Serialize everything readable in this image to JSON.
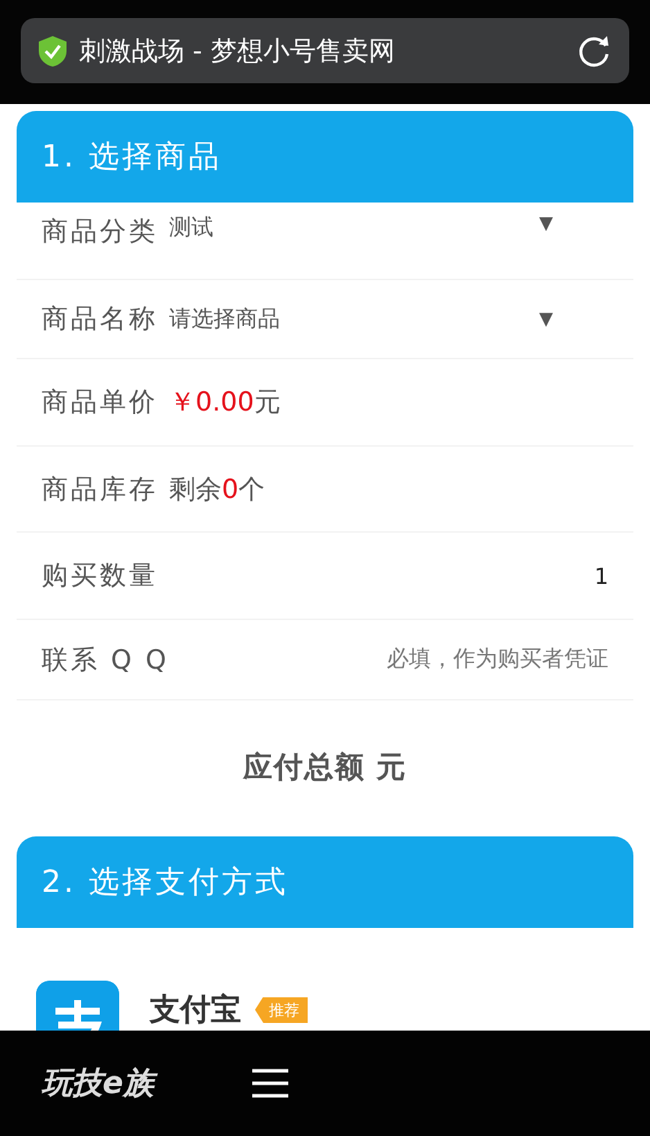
{
  "address_bar": {
    "title": "刺激战场 - 梦想小号售卖网",
    "secure": true
  },
  "product_section": {
    "heading": "1. 选择商品",
    "rows": [
      {
        "kind": "select",
        "label": "商品分类",
        "value": "测试",
        "arrow": "▼"
      },
      {
        "kind": "select",
        "label": "商品名称",
        "value": "请选择商品",
        "arrow": "▼"
      },
      {
        "kind": "price",
        "label": "商品单价",
        "amount": "￥0.00",
        "unit": "元"
      },
      {
        "kind": "stock",
        "label": "商品库存",
        "prefix": "剩余",
        "count": "0",
        "unit": "个"
      },
      {
        "kind": "input",
        "label": "购买数量",
        "value": "1"
      },
      {
        "kind": "input",
        "label": "联系 Q Q",
        "placeholder": "必填，作为购买者凭证"
      }
    ]
  },
  "total": "应付总额 元",
  "payment_section": {
    "heading": "2. 选择支付方式",
    "methods": [
      {
        "name": "支付宝",
        "badge": "推荐"
      }
    ]
  },
  "bottom_bar": {
    "logo": "玩技e族"
  }
}
